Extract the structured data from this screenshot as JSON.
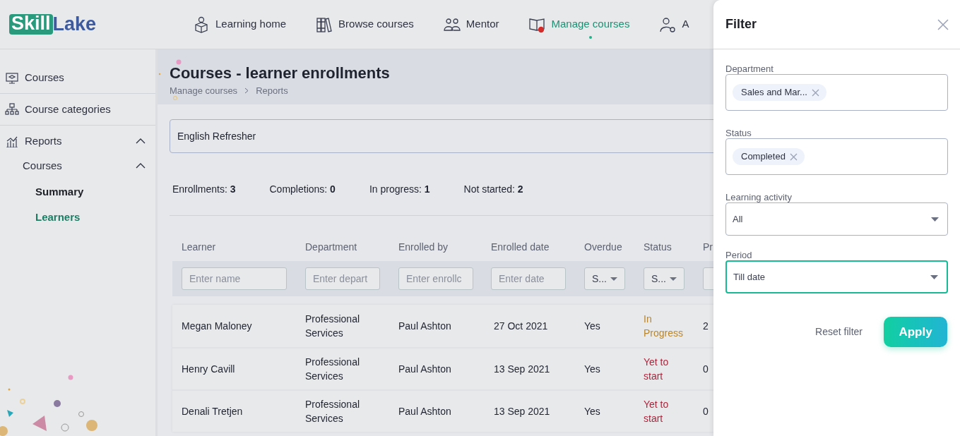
{
  "logo": {
    "part1": "Skill",
    "part2": "Lake"
  },
  "nav": [
    {
      "label": "Learning home",
      "selected": false
    },
    {
      "label": "Browse courses",
      "selected": false
    },
    {
      "label": "Mentor",
      "selected": false
    },
    {
      "label": "Manage courses",
      "selected": true
    },
    {
      "label": "A",
      "selected": false
    }
  ],
  "sidebar": {
    "items": [
      {
        "label": "Courses",
        "selected": false
      },
      {
        "label": "Course categories",
        "selected": false
      },
      {
        "label": "Reports",
        "expanded": true,
        "selected": false,
        "children": [
          {
            "label": "Courses",
            "expanded": true,
            "selected": false,
            "children": [
              {
                "label": "Summary",
                "selected": false
              },
              {
                "label": "Learners",
                "selected": true
              }
            ]
          }
        ]
      }
    ]
  },
  "page": {
    "title": "Courses - learner enrollments",
    "breadcrumb": [
      "Manage courses",
      "Reports"
    ]
  },
  "course_select": {
    "value": "English Refresher"
  },
  "stats": [
    {
      "label": "Enrollments:",
      "value": "3"
    },
    {
      "label": "Completions:",
      "value": "0"
    },
    {
      "label": "In progress:",
      "value": "1"
    },
    {
      "label": "Not started:",
      "value": "2"
    }
  ],
  "table": {
    "columns": [
      {
        "label": "Learner",
        "filter": {
          "kind": "text",
          "placeholder": "Enter name"
        }
      },
      {
        "label": "Department",
        "filter": {
          "kind": "text",
          "placeholder": "Enter depart"
        }
      },
      {
        "label": "Enrolled by",
        "filter": {
          "kind": "text",
          "placeholder": "Enter enrollc"
        }
      },
      {
        "label": "Enrolled date",
        "filter": {
          "kind": "text",
          "placeholder": "Enter date"
        }
      },
      {
        "label": "Overdue",
        "filter": {
          "kind": "select",
          "value": "S..."
        }
      },
      {
        "label": "Status",
        "filter": {
          "kind": "select",
          "value": "S..."
        }
      },
      {
        "label": "Pr",
        "filter": {
          "kind": "text"
        }
      }
    ],
    "rows": [
      {
        "learner": "Megan Maloney",
        "department": "Professional Services",
        "enrolled_by": "Paul Ashton",
        "enrolled_date": "27 Oct 2021",
        "overdue": "Yes",
        "status": {
          "text": "In Progress",
          "color": "#b8862e"
        },
        "column_7": "2"
      },
      {
        "learner": "Henry Cavill",
        "department": "Professional Services",
        "enrolled_by": "Paul Ashton",
        "enrolled_date": "13 Sep 2021",
        "overdue": "Yes",
        "status": {
          "text": "Yet to start",
          "color": "#b0253c"
        },
        "column_7": "0"
      },
      {
        "learner": "Denali Tretjen",
        "department": "Professional Services",
        "enrolled_by": "Paul Ashton",
        "enrolled_date": "13 Sep 2021",
        "overdue": "Yes",
        "status": {
          "text": "Yet to start",
          "color": "#b0253c"
        },
        "column_7": "0"
      }
    ]
  },
  "filter_panel": {
    "title": "Filter",
    "fields": [
      {
        "label": "Department",
        "kind": "tags",
        "tags": [
          "Sales and Mar..."
        ],
        "focused": false
      },
      {
        "label": "Status",
        "kind": "tags",
        "tags": [
          "Completed"
        ],
        "focused": false
      },
      {
        "label": "Learning activity",
        "kind": "select",
        "value": "All",
        "focused": false
      },
      {
        "label": "Period",
        "kind": "select",
        "value": "Till date",
        "focused": true
      }
    ],
    "reset_label": "Reset filter",
    "apply_label": "Apply"
  }
}
